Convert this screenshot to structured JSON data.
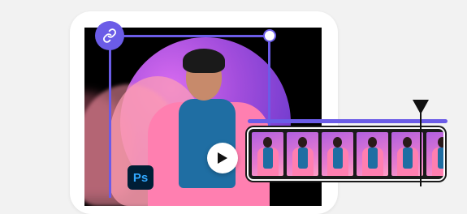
{
  "badge": {
    "label": "Ps",
    "bg": "#001e36",
    "fg": "#31a8ff"
  },
  "colors": {
    "accent": "#6b5ce7",
    "timeline_dark": "#1a1a1a",
    "page_bg": "#f2f2f2"
  },
  "icons": {
    "link": "link-icon",
    "play": "play-icon",
    "playhead": "playhead-marker-icon",
    "handle": "resize-handle-icon"
  },
  "timeline": {
    "thumbnail_count": 6
  }
}
